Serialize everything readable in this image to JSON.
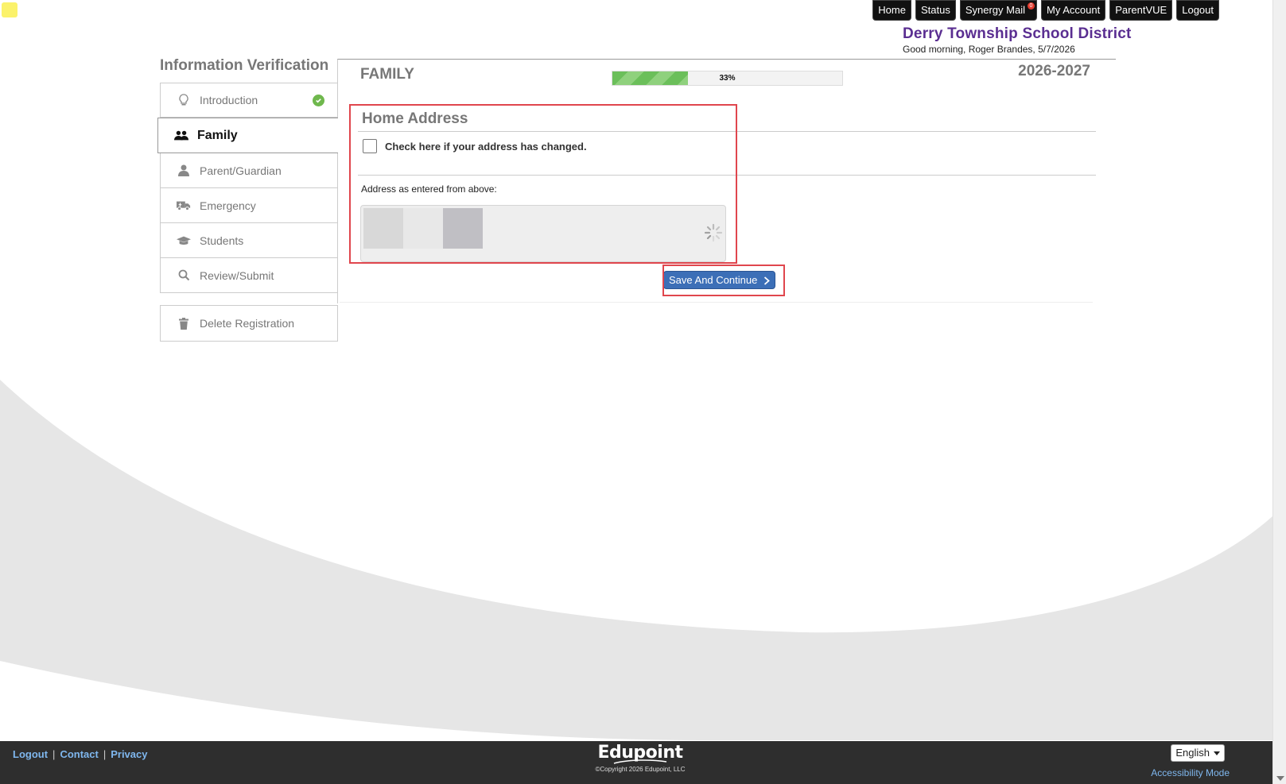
{
  "top_nav": {
    "items": [
      "Home",
      "Status",
      "Synergy Mail",
      "My Account",
      "ParentVUE",
      "Logout"
    ],
    "mail_badge": "0"
  },
  "district": {
    "name": "Derry Township School District",
    "greeting": "Good morning, Roger Brandes, 5/7/2026"
  },
  "sidebar": {
    "title": "Information Verification",
    "items": [
      {
        "label": "Introduction",
        "icon": "lightbulb-icon",
        "completed": true
      },
      {
        "label": "Family",
        "icon": "users-icon",
        "active": true
      },
      {
        "label": "Parent/Guardian",
        "icon": "user-icon"
      },
      {
        "label": "Emergency",
        "icon": "ambulance-icon"
      },
      {
        "label": "Students",
        "icon": "graduation-cap-icon"
      },
      {
        "label": "Review/Submit",
        "icon": "search-icon"
      }
    ],
    "delete_label": "Delete Registration"
  },
  "main": {
    "title": "FAMILY",
    "progress_label": "33%",
    "progress_fraction": 0.33,
    "school_year": "2026-2027",
    "section_title": "Home Address",
    "address_changed_label": "Check here if your address has changed.",
    "address_changed_checked": false,
    "address_label": "Address as entered from above:",
    "save_label": "Save And Continue"
  },
  "footer": {
    "links": [
      "Logout",
      "Contact",
      "Privacy"
    ],
    "brand": "Edupoint",
    "copyright": "©Copyright 2026 Edupoint, LLC",
    "language": "English",
    "accessibility": "Accessibility Mode"
  },
  "colors": {
    "district_purple": "#5a2e91",
    "progress_green": "#6bbf5a",
    "save_blue": "#3c6fb7",
    "highlight_red": "#e0464d",
    "footer_bg": "#2e2e2e",
    "link_blue": "#7fb7ee"
  }
}
